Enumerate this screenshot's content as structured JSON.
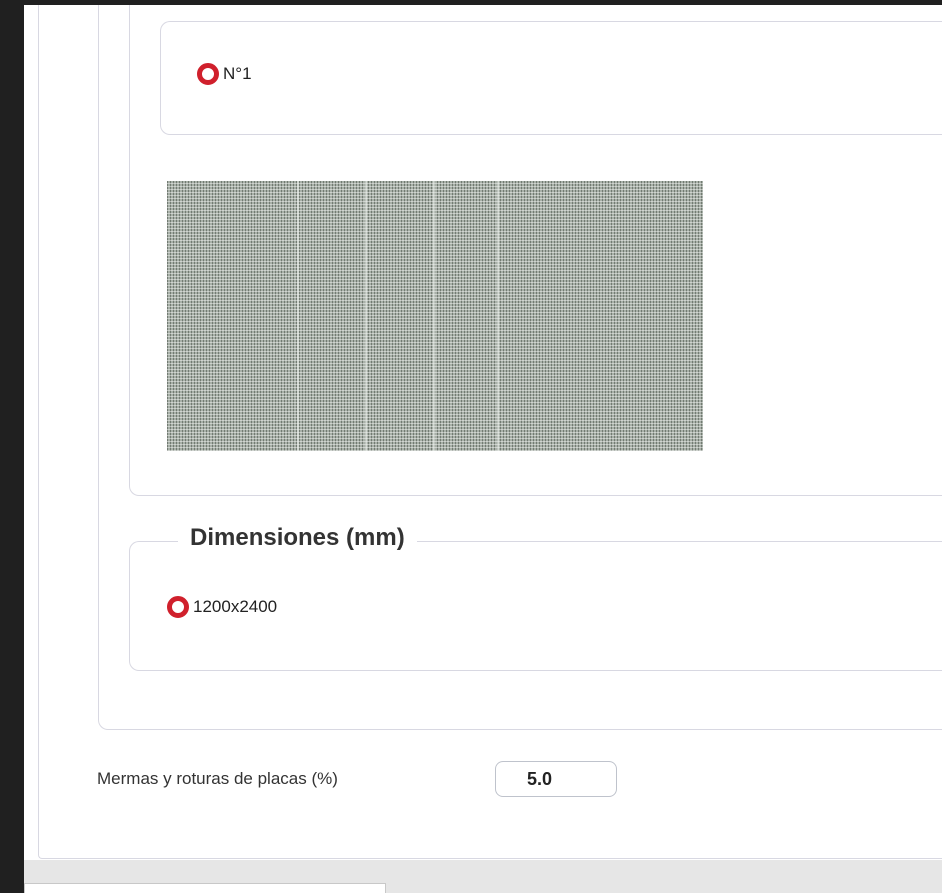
{
  "options": {
    "n1_label": "N°1"
  },
  "dimensions": {
    "legend": "Dimensiones (mm)",
    "option_label": "1200x2400"
  },
  "mermas": {
    "label": "Mermas y roturas de placas (%)",
    "value": "5.0"
  },
  "colors": {
    "radio_accent": "#d0202c",
    "swatch": "#a8b0a8"
  }
}
